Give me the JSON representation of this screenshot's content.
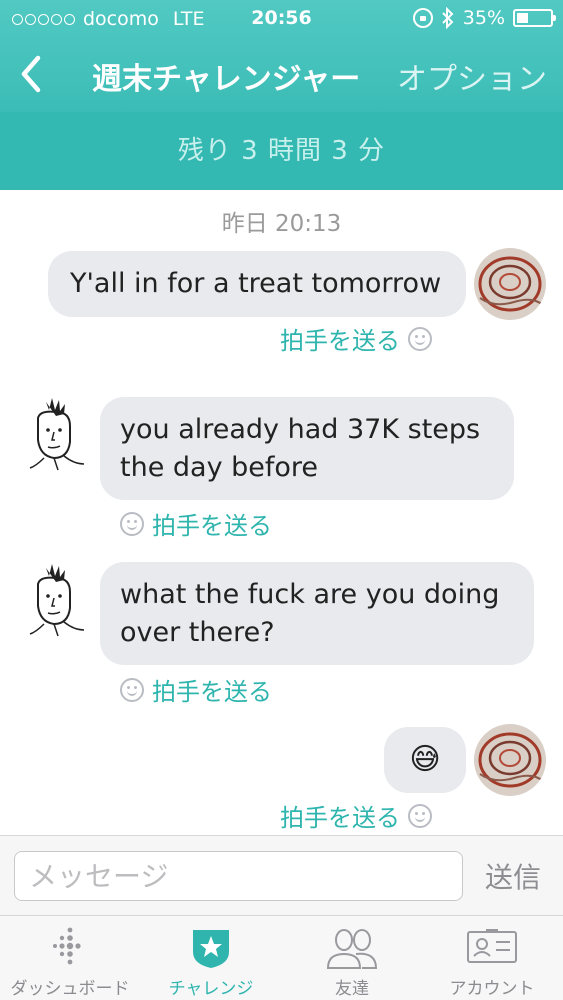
{
  "status_bar": {
    "carrier": "docomo",
    "network": "LTE",
    "time": "20:56",
    "battery": "35%",
    "battery_level": 0.35
  },
  "nav": {
    "title": "週末チャレンジャー",
    "option": "オプション"
  },
  "countdown": "残り 3 時間 3 分",
  "chat": {
    "date": "昨日 20:13",
    "messages": [
      {
        "from": "self",
        "text": "Y'all in for a treat tomorrow",
        "cheer": "拍手を送る"
      },
      {
        "from": "other",
        "line1": "you already had 37K steps",
        "line2": "the day before",
        "cheer": "拍手を送る"
      },
      {
        "from": "other",
        "line1": "what the fuck are you doing",
        "line2": "over there?",
        "cheer": "拍手を送る"
      },
      {
        "from": "self",
        "text": "😅",
        "cheer": "拍手を送る"
      }
    ]
  },
  "composer": {
    "placeholder": "メッセージ",
    "send": "送信"
  },
  "tabs": [
    {
      "label": "ダッシュボード",
      "icon": "dashboard-dots-icon"
    },
    {
      "label": "チャレンジ",
      "icon": "challenge-star-icon",
      "active": true
    },
    {
      "label": "友達",
      "icon": "friends-icon"
    },
    {
      "label": "アカウント",
      "icon": "account-card-icon"
    }
  ],
  "colors": {
    "header": "#3bbcb6",
    "accent": "#2fb5ae",
    "bubble": "#e8eaee"
  }
}
